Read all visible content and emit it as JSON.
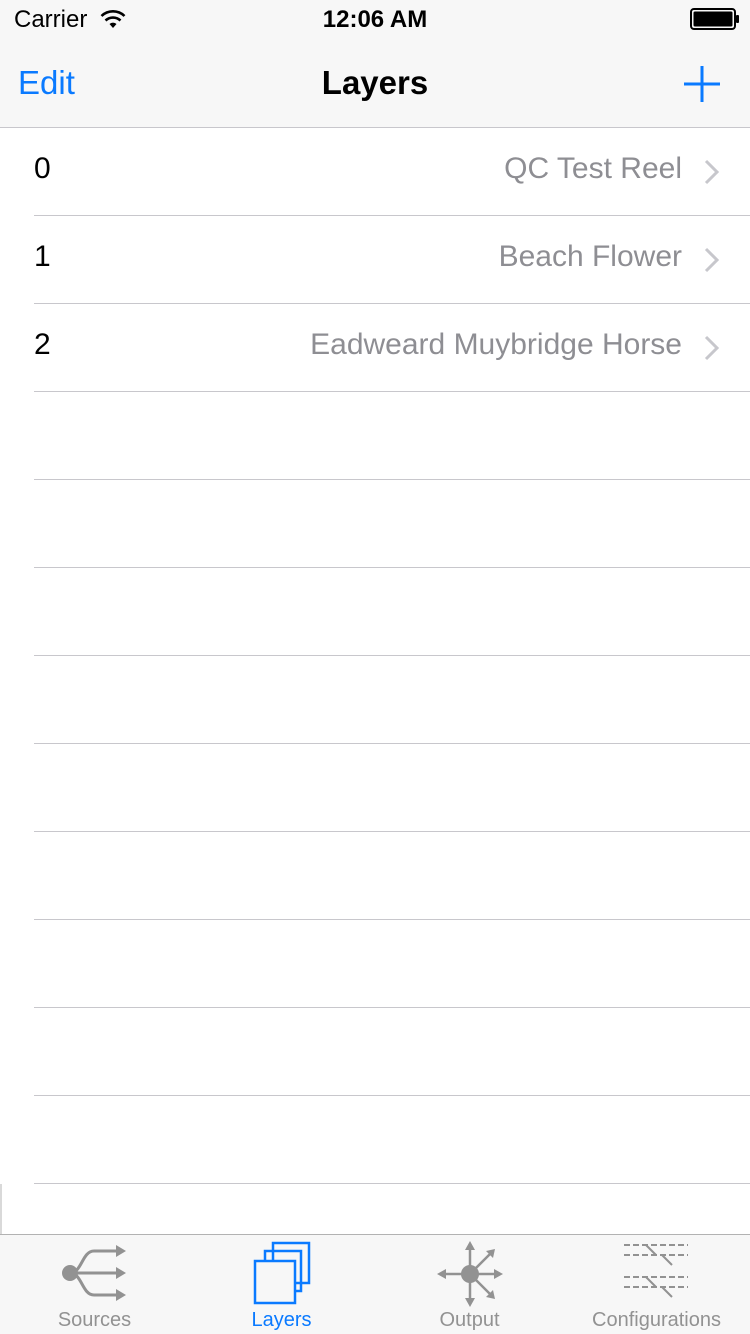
{
  "status_bar": {
    "carrier": "Carrier",
    "time": "12:06 AM",
    "wifi_icon": "wifi-icon",
    "battery_icon": "battery-icon"
  },
  "nav": {
    "edit_label": "Edit",
    "title": "Layers",
    "add_icon": "plus-icon"
  },
  "layers": [
    {
      "index": "0",
      "name": "QC Test Reel"
    },
    {
      "index": "1",
      "name": "Beach Flower"
    },
    {
      "index": "2",
      "name": "Eadweard Muybridge Horse"
    }
  ],
  "tabs": [
    {
      "label": "Sources",
      "icon": "sources-icon",
      "active": false
    },
    {
      "label": "Layers",
      "icon": "layers-icon",
      "active": true
    },
    {
      "label": "Output",
      "icon": "output-icon",
      "active": false
    },
    {
      "label": "Configurations",
      "icon": "configurations-icon",
      "active": false
    }
  ],
  "colors": {
    "accent": "#0a7aff",
    "secondary_text": "#8e8e93",
    "separator": "#c8c7cc",
    "tab_inactive": "#929292",
    "bar_background": "#f7f7f7"
  }
}
